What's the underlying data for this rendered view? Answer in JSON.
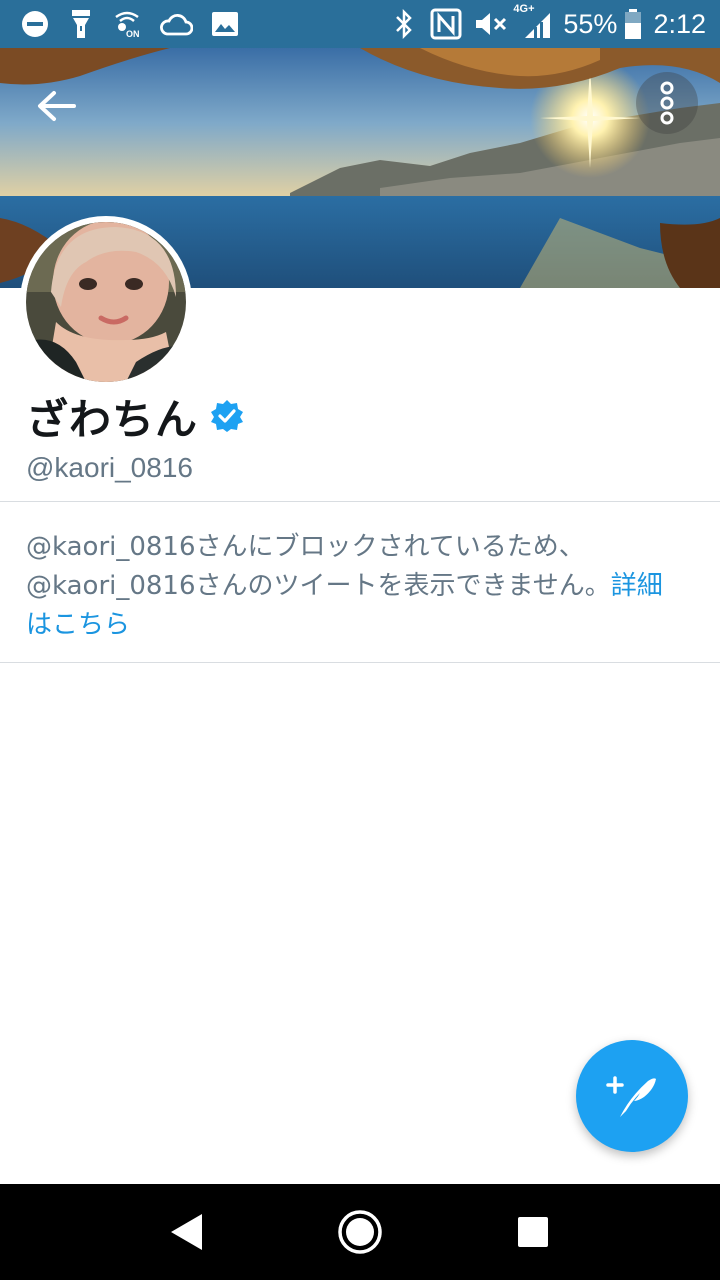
{
  "status_bar": {
    "battery_percent": "55%",
    "time": "2:12",
    "network": "4G+",
    "icons_left": [
      "do-not-disturb-icon",
      "flashlight-icon",
      "vowifi-icon",
      "cloud-icon",
      "image-icon"
    ],
    "icons_right": [
      "bluetooth-icon",
      "nfc-icon",
      "mute-icon",
      "signal-icon",
      "battery-icon"
    ],
    "background_color": "#2a6f9a"
  },
  "profile": {
    "display_name": "ざわちん",
    "username": "@kaori_0816",
    "verified": true
  },
  "blocked_notice": {
    "line1": "@kaori_0816さんにブロックされているため、",
    "line2": "@kaori_0816さんのツイートを表示できません。",
    "link_part1": "詳細",
    "link_part2": "はこちら"
  },
  "colors": {
    "accent": "#1da1f2",
    "link": "#1b95e0",
    "secondary_text": "#657786",
    "primary_text": "#14171a"
  },
  "icons": {
    "back": "arrow-left-icon",
    "overflow": "more-vertical-icon",
    "verified": "verified-badge-icon",
    "compose": "compose-tweet-icon",
    "nav_back": "triangle-back-icon",
    "nav_home": "circle-home-icon",
    "nav_recents": "square-recents-icon"
  }
}
